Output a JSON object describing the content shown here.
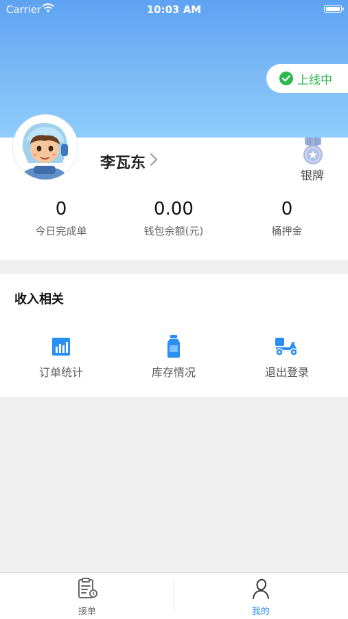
{
  "status_bar": {
    "carrier": "Carrier",
    "time": "10:03 AM"
  },
  "online_status": {
    "label": "上线中",
    "color": "#2db84d"
  },
  "profile": {
    "name": "李瓦东",
    "medal_label": "银牌"
  },
  "stats": [
    {
      "value": "0",
      "label": "今日完成单"
    },
    {
      "value": "0.00",
      "label": "钱包余额(元)"
    },
    {
      "value": "0",
      "label": "桶押金"
    }
  ],
  "income": {
    "title": "收入相关",
    "items": [
      {
        "label": "订单统计",
        "icon": "bar-chart-icon"
      },
      {
        "label": "库存情况",
        "icon": "water-bottle-icon"
      },
      {
        "label": "退出登录",
        "icon": "delivery-scooter-icon"
      }
    ]
  },
  "tabs": [
    {
      "label": "接单",
      "icon": "clipboard-icon",
      "active": false
    },
    {
      "label": "我的",
      "icon": "person-icon",
      "active": true
    }
  ],
  "colors": {
    "accent": "#2a8ef2",
    "online": "#2db84d",
    "header": "#6aaef4"
  }
}
